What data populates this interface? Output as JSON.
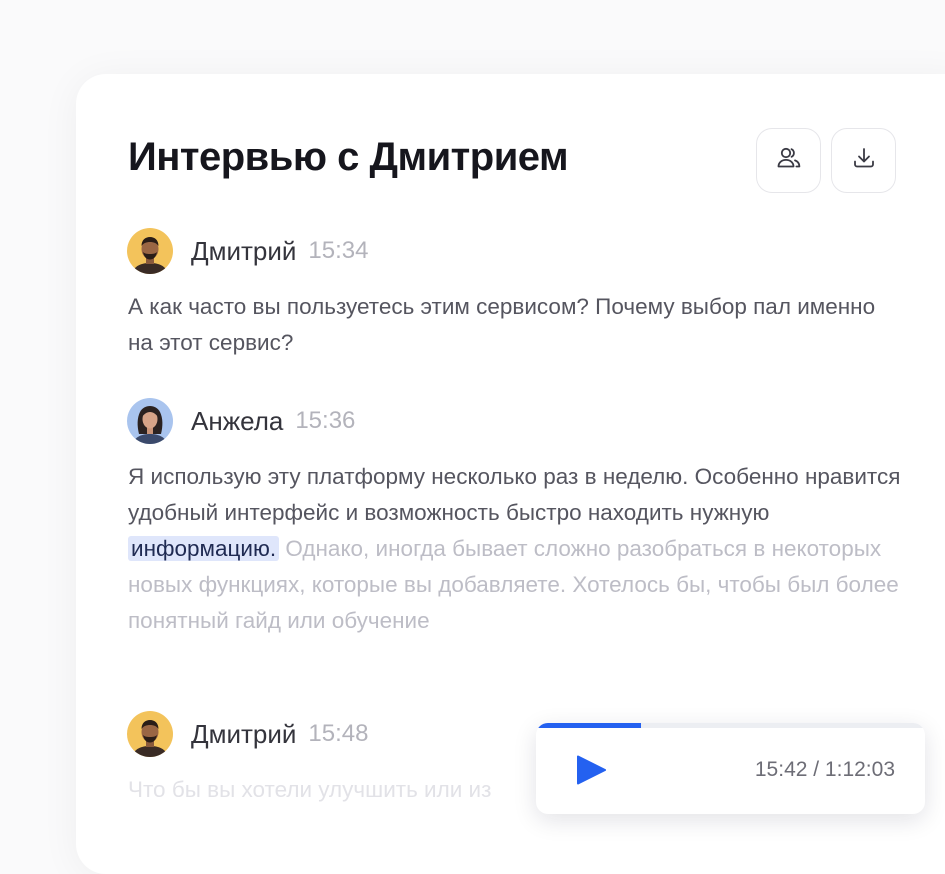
{
  "header": {
    "title": "Интервью с Дмитрием",
    "participants_icon": "users-icon",
    "download_icon": "download-icon"
  },
  "messages": [
    {
      "speaker": "Дмитрий",
      "time": "15:34",
      "avatar_bg": "#f3c35b",
      "text": "А как часто вы пользуетесь этим сервисом? Почему выбор пал именно на этот сервис?"
    },
    {
      "speaker": "Анжела",
      "time": "15:36",
      "avatar_bg": "#a9c4ee",
      "text_played": "Я использую эту платформу несколько раз в неделю. Особенно нравится удобный интерфейс и возможность быстро находить нужную",
      "text_current": "информацию.",
      "text_upcoming": "Однако, иногда бывает сложно разобраться в некоторых новых функциях, которые вы добавляете. Хотелось бы, чтобы был более понятный гайд или обучение"
    },
    {
      "speaker": "Дмитрий",
      "time": "15:48",
      "avatar_bg": "#f3c35b",
      "text": "Что бы вы хотели улучшить или из"
    }
  ],
  "player": {
    "play_icon": "play-icon",
    "time_display": "15:42 / 1:12:03",
    "progress_fraction": 0.27,
    "accent": "#2461f0"
  }
}
